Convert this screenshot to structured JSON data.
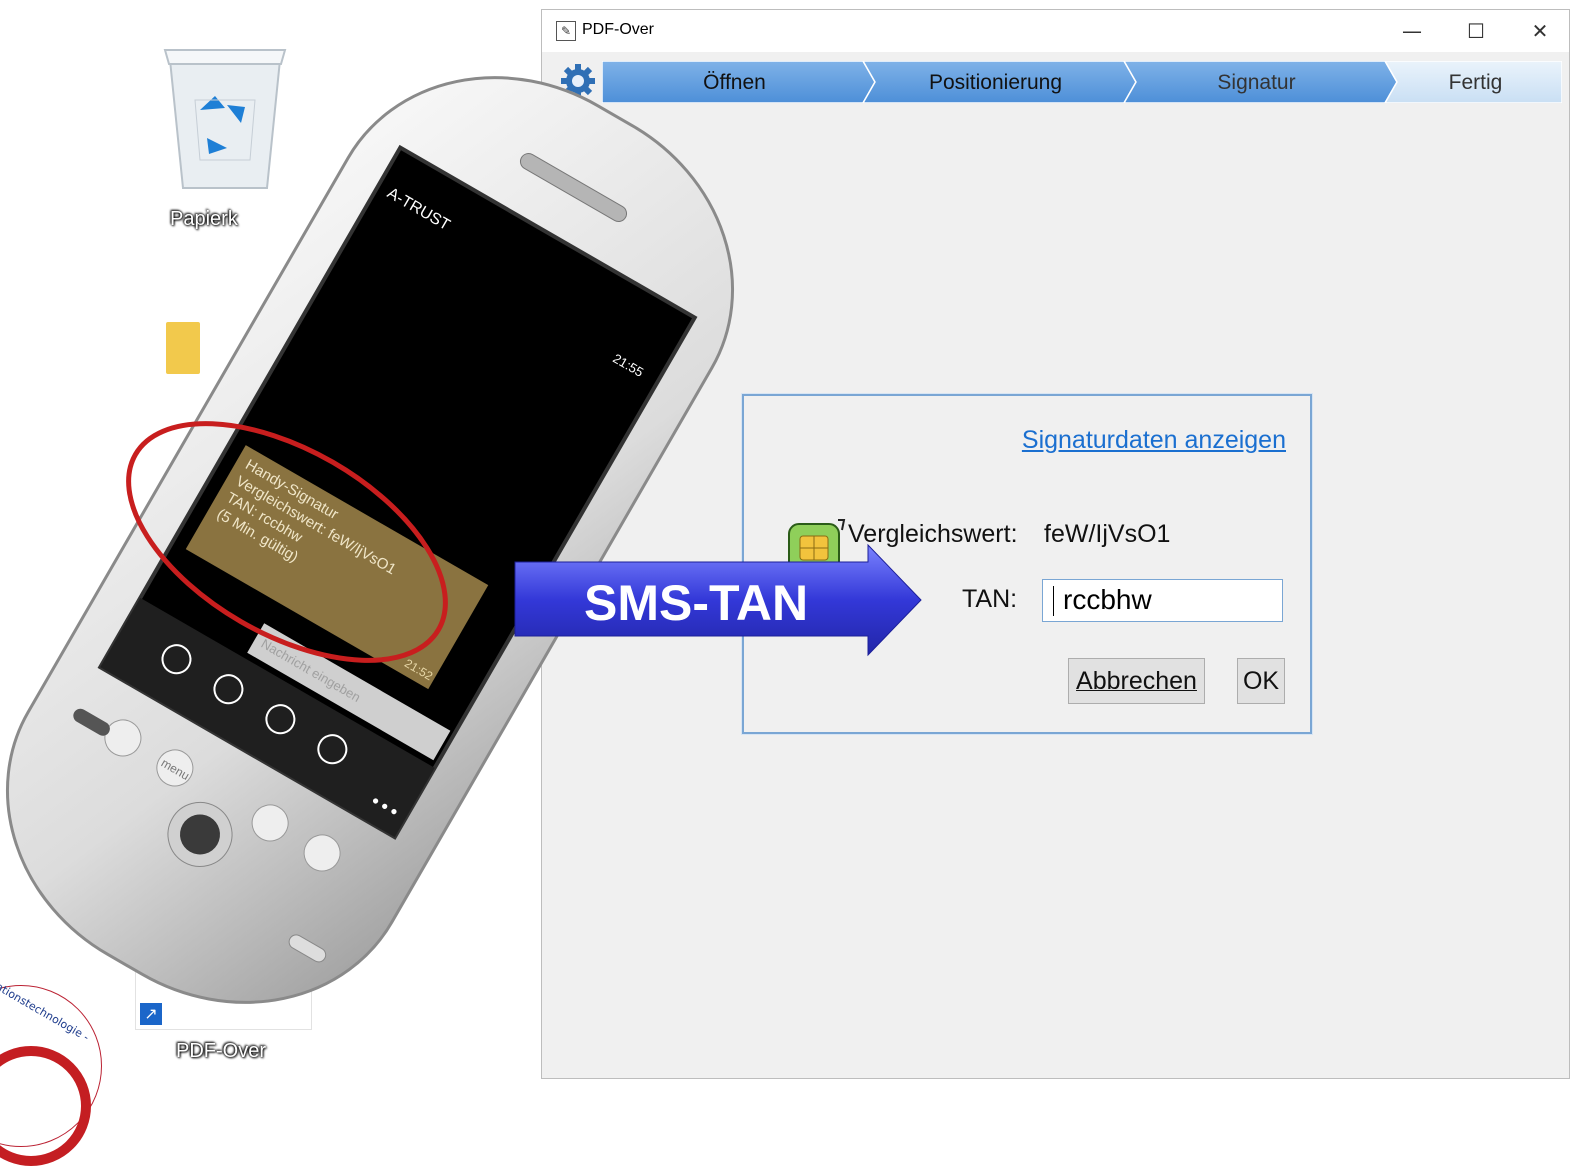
{
  "desktop": {
    "recycle_bin_label": "Papierk",
    "shortcut_label": "PDF-Over",
    "logo_text": "ationstechnologie - Austria"
  },
  "window": {
    "title": "PDF-Over",
    "minimize_icon": "minimize-icon",
    "maximize_icon": "maximize-icon",
    "close_icon": "close-icon",
    "steps": [
      "Öffnen",
      "Positionierung",
      "Signatur",
      "Fertig"
    ],
    "active_steps": 3
  },
  "dialog": {
    "show_signature_data_link": "Signaturdaten anzeigen",
    "comparison_label": "Vergleichswert:",
    "comparison_value": "feW/IjVsO1",
    "tan_label": "TAN:",
    "tan_value": "rccbhw",
    "cancel_button": "Abbrechen",
    "ok_button": "OK"
  },
  "phone": {
    "carrier": "A-TRUST",
    "clock": "21:55",
    "sms": {
      "lines": [
        "Handy-Signatur",
        "Vergleichswert: feW/IjVsO1",
        "TAN: rccbhw",
        "(5 Min. gültig)"
      ],
      "time": "21:52"
    },
    "input_placeholder": "Nachricht eingeben",
    "menu_key": "menu"
  },
  "callout": {
    "label": "SMS-TAN",
    "highlight_color": "#c81e1e",
    "arrow_color": "#3d3fd8"
  }
}
